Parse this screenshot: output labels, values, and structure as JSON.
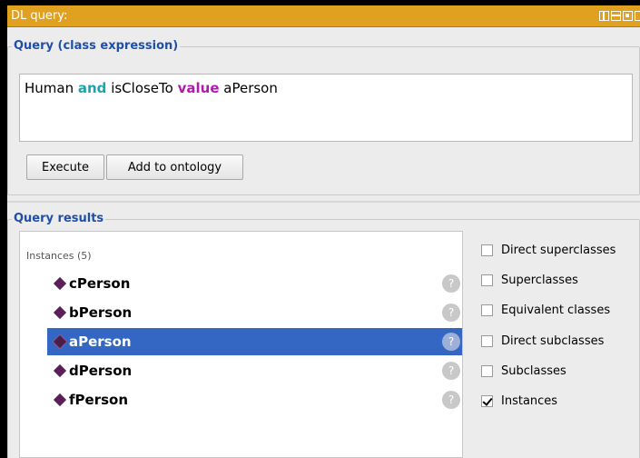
{
  "window": {
    "title": "DL query:",
    "accent_color": "#e0a020"
  },
  "query_section": {
    "legend": "Query (class expression)",
    "expression": {
      "part1": "Human ",
      "kw_and": "and",
      "part2": " isCloseTo ",
      "kw_value": "value",
      "part3": " aPerson"
    },
    "execute_label": "Execute",
    "add_label": "Add to ontology"
  },
  "results_section": {
    "legend": "Query results",
    "list_header": "Instances (5)",
    "items": [
      {
        "label": "cPerson",
        "help": "?"
      },
      {
        "label": "bPerson",
        "help": "?"
      },
      {
        "label": "aPerson",
        "help": "?",
        "selected": true
      },
      {
        "label": "dPerson",
        "help": "?"
      },
      {
        "label": "fPerson",
        "help": "?"
      }
    ],
    "options": [
      {
        "label": "Direct superclasses",
        "checked": false
      },
      {
        "label": "Superclasses",
        "checked": false
      },
      {
        "label": "Equivalent classes",
        "checked": false
      },
      {
        "label": "Direct subclasses",
        "checked": false
      },
      {
        "label": "Subclasses",
        "checked": false
      },
      {
        "label": "Instances",
        "checked": true
      }
    ],
    "selection_color": "#3467c4"
  }
}
